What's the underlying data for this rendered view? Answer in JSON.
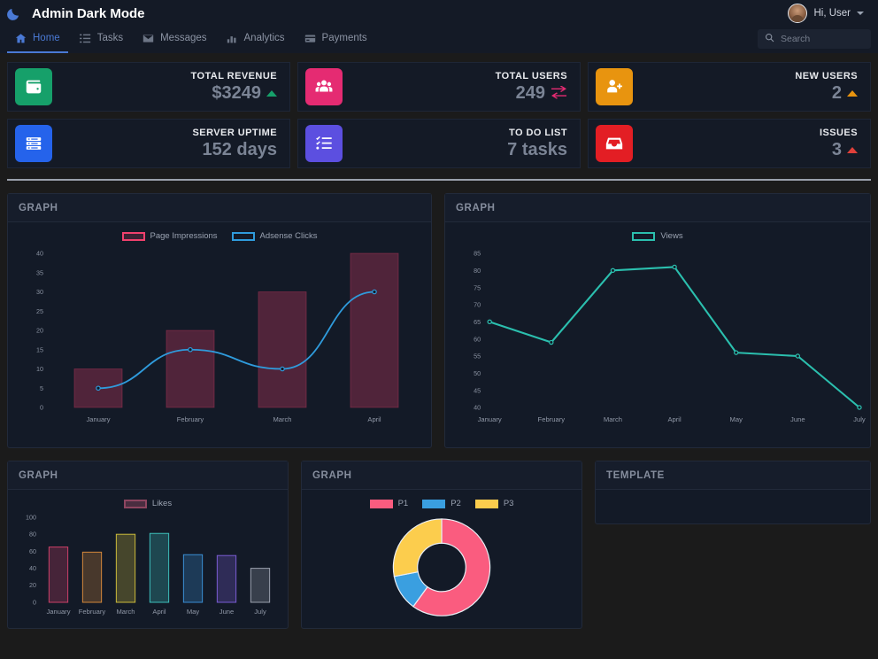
{
  "header": {
    "brand_title": "Admin Dark Mode",
    "brand_icon": "moon-icon",
    "user_greeting": "Hi, User",
    "avatar_icon": "avatar",
    "caret_icon": "chevron-down-icon",
    "nav_items": [
      {
        "label": "Home",
        "icon": "home-icon",
        "active": true
      },
      {
        "label": "Tasks",
        "icon": "list-icon",
        "active": false
      },
      {
        "label": "Messages",
        "icon": "envelope-icon",
        "active": false
      },
      {
        "label": "Analytics",
        "icon": "chart-bar-icon",
        "active": false
      },
      {
        "label": "Payments",
        "icon": "credit-card-icon",
        "active": false
      }
    ],
    "search": {
      "placeholder": "Search",
      "value": "",
      "icon": "search-icon"
    },
    "accent_color": "#4a79d4"
  },
  "stat_cards": [
    {
      "title": "TOTAL REVENUE",
      "value": "$3249",
      "icon": "wallet-icon",
      "icon_color": "#16a06a",
      "trend": "up",
      "trend_color": "#16a06a"
    },
    {
      "title": "TOTAL USERS",
      "value": "249",
      "icon": "users-icon",
      "icon_color": "#e52b72",
      "trend": "swap",
      "trend_color": "#e52b72"
    },
    {
      "title": "NEW USERS",
      "value": "2",
      "icon": "user-plus-icon",
      "icon_color": "#e8940f",
      "trend": "up",
      "trend_color": "#e8940f"
    },
    {
      "title": "SERVER UPTIME",
      "value": "152 days",
      "icon": "server-icon",
      "icon_color": "#2563eb",
      "trend": "none",
      "trend_color": ""
    },
    {
      "title": "TO DO LIST",
      "value": "7 tasks",
      "icon": "tasks-icon",
      "icon_color": "#5c4fe0",
      "trend": "none",
      "trend_color": ""
    },
    {
      "title": "ISSUES",
      "value": "3",
      "icon": "inbox-icon",
      "icon_color": "#e31e24",
      "trend": "up",
      "trend_color": "#e0403a"
    }
  ],
  "panels": {
    "graph_1_title": "GRAPH",
    "graph_2_title": "GRAPH",
    "graph_3_title": "GRAPH",
    "graph_4_title": "GRAPH",
    "template_title": "TEMPLATE"
  },
  "chart_data": [
    {
      "type": "bar",
      "id": "page-impressions-adsense",
      "title": "GRAPH",
      "categories": [
        "January",
        "February",
        "March",
        "April"
      ],
      "series": [
        {
          "name": "Page Impressions",
          "type": "bar",
          "values": [
            10,
            20,
            30,
            40
          ],
          "color": "#f0406d",
          "fill": "rgba(240,64,109,0.28)"
        },
        {
          "name": "Adsense Clicks",
          "type": "line",
          "values": [
            5,
            15,
            10,
            30
          ],
          "color": "#2f9bdc"
        }
      ],
      "ylim": [
        0,
        40
      ],
      "yticks": [
        0,
        5,
        10,
        15,
        20,
        25,
        30,
        35,
        40
      ],
      "xlabel": "",
      "ylabel": "",
      "grid": false,
      "legend": "top"
    },
    {
      "type": "line",
      "id": "views",
      "title": "GRAPH",
      "categories": [
        "January",
        "February",
        "March",
        "April",
        "May",
        "June",
        "July"
      ],
      "series": [
        {
          "name": "Views",
          "values": [
            65,
            59,
            80,
            81,
            56,
            55,
            40
          ],
          "color": "#2bbfae"
        }
      ],
      "ylim": [
        40,
        85
      ],
      "yticks": [
        40,
        45,
        50,
        55,
        60,
        65,
        70,
        75,
        80,
        85
      ],
      "xlabel": "",
      "ylabel": "",
      "grid": false,
      "legend": "top"
    },
    {
      "type": "bar",
      "id": "likes",
      "title": "GRAPH",
      "categories": [
        "January",
        "February",
        "March",
        "April",
        "May",
        "June",
        "July"
      ],
      "series": [
        {
          "name": "Likes",
          "values": [
            65,
            59,
            80,
            81,
            56,
            55,
            40
          ],
          "colors": [
            "#cc4068",
            "#d4883a",
            "#cbbb3a",
            "#3ec0bb",
            "#3a8fd4",
            "#7a5cd4",
            "#9aa0ad"
          ]
        }
      ],
      "ylim": [
        0,
        100
      ],
      "yticks": [
        0,
        20,
        40,
        60,
        80,
        100
      ],
      "xlabel": "",
      "ylabel": "",
      "grid": false,
      "legend": "top"
    },
    {
      "type": "pie",
      "id": "p1-p2-p3-donut",
      "title": "GRAPH",
      "labels": [
        "P1",
        "P2",
        "P3"
      ],
      "values": [
        60,
        12,
        28
      ],
      "colors": [
        "#fa5c7f",
        "#3a9fe0",
        "#fccd4d"
      ],
      "donut": true,
      "legend": "top"
    }
  ]
}
